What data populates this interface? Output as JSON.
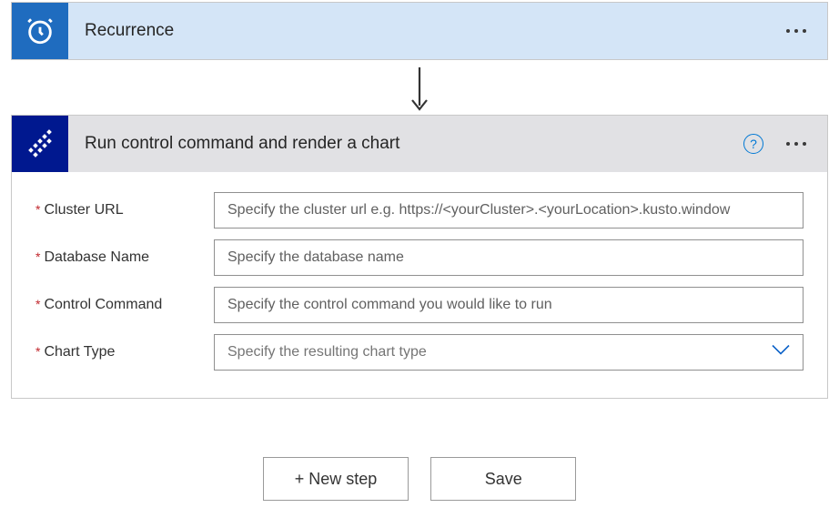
{
  "recurrence": {
    "title": "Recurrence"
  },
  "action": {
    "title": "Run control command and render a chart",
    "help_tooltip": "?",
    "fields": {
      "cluster_url": {
        "label": "Cluster URL",
        "placeholder": "Specify the cluster url e.g. https://<yourCluster>.<yourLocation>.kusto.window"
      },
      "database_name": {
        "label": "Database Name",
        "placeholder": "Specify the database name"
      },
      "control_command": {
        "label": "Control Command",
        "placeholder": "Specify the control command you would like to run"
      },
      "chart_type": {
        "label": "Chart Type",
        "placeholder": "Specify the resulting chart type"
      }
    }
  },
  "buttons": {
    "new_step": "+ New step",
    "save": "Save"
  }
}
